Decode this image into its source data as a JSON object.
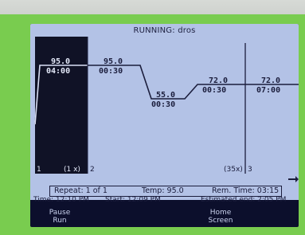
{
  "screen": {
    "title": "RUNNING: dros"
  },
  "steps": [
    {
      "temp": "95.0",
      "time": "04:00"
    },
    {
      "temp": "95.0",
      "time": "00:30"
    },
    {
      "temp": "55.0",
      "time": "00:30"
    },
    {
      "temp": "72.0",
      "time": "00:30"
    },
    {
      "temp": "72.0",
      "time": "07:00"
    }
  ],
  "step_markers": {
    "m1": "1",
    "m1_repeat": "(1 x)",
    "m2": "2",
    "m2_repeat": "(35x)",
    "m3": "3"
  },
  "status": {
    "repeat": "Repeat: 1 of 1",
    "temp": "Temp: 95.0",
    "rem_time": "Rem. Time: 03:15",
    "time": "Time: 12:10 PM",
    "start": "Start: 12:09 PM",
    "estimated_end": "Estimated end: 2:05 PM"
  },
  "softkeys": {
    "pause_line1": "Pause",
    "pause_line2": "Run",
    "home_line1": "Home",
    "home_line2": "Screen"
  },
  "colors": {
    "lcd_background": "#b3c2e6",
    "bezel": "#79cc4f",
    "active_step": "#101226"
  }
}
